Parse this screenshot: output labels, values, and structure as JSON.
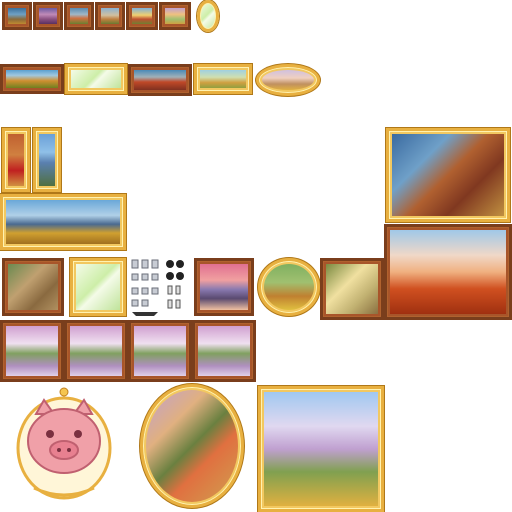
{
  "sheet": {
    "background": "#ffffff",
    "sprite_count": 34
  },
  "palette": {
    "wood_dark": "#7a3e1c",
    "wood_light": "#b0622e",
    "gold": "#e8b040",
    "gold_light": "#fff2b0",
    "mirror_green": "#cdeea8",
    "pig_pink": "#f0a0a8"
  },
  "icons": {
    "hardware": "screws-and-hooks-icon",
    "pig": "pig-face-icon"
  }
}
